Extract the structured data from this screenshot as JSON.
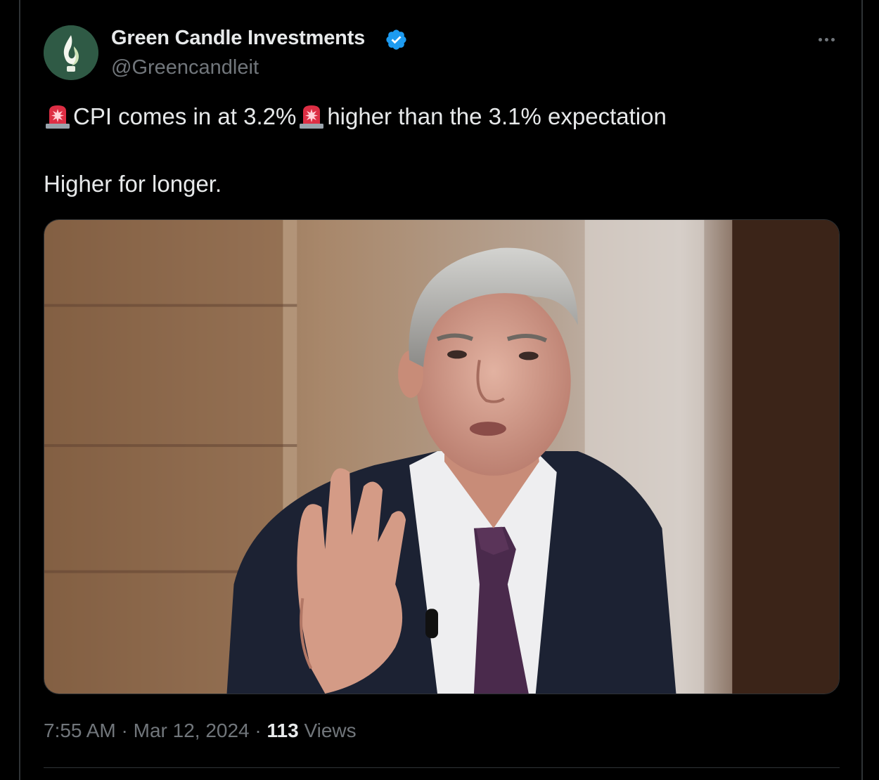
{
  "tweet": {
    "display_name": "Green Candle Investments",
    "handle": "@Greencandleit",
    "verified": true,
    "more_icon": "more-horizontal-icon",
    "text": {
      "emoji": "police-car-light",
      "segment1": "CPI comes in at 3.2%",
      "segment2": "higher than the 3.1% expectation",
      "line2": "Higher for longer."
    },
    "media": {
      "type": "photo"
    },
    "meta": {
      "time": "7:55 AM",
      "separator": "·",
      "date": "Mar 12, 2024",
      "views_count": "113",
      "views_label": "Views"
    }
  },
  "colors": {
    "background": "#000000",
    "text": "#e7e9ea",
    "secondary": "#71767b",
    "verified": "#1d9bf0",
    "border": "#2f3336"
  }
}
